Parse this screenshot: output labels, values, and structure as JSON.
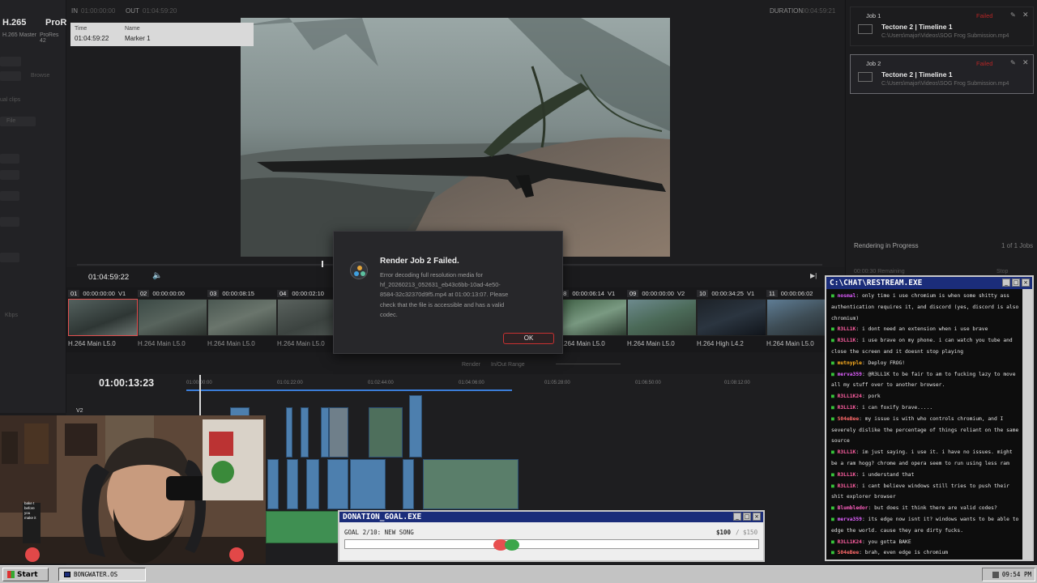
{
  "left_panel": {
    "format_title": "H.265",
    "format_sub": "H.265 Master",
    "format_title2": "ProRe",
    "format_sub2": "ProRes 42",
    "ghost_labels": [
      "Browse",
      "ual clips",
      "File",
      "Kbps"
    ]
  },
  "viewer": {
    "in_label": "IN",
    "in_tc": "01:00:00:00",
    "out_label": "OUT",
    "out_tc": "01:04:59:20",
    "duration_label": "DURATION",
    "duration_tc": "00:04:59:21",
    "marker_time_label": "Time",
    "marker_time": "01:04:59:22",
    "marker_name_label": "Name",
    "marker_name": "Marker 1",
    "timecode": "01:04:59:22"
  },
  "clips": [
    {
      "idx": "01",
      "tc": "00:00:00:00",
      "track": "V1",
      "codec": "H.264 Main L5.0"
    },
    {
      "idx": "02",
      "tc": "00:00:00:00",
      "track": "",
      "codec": "H.264 Main L5.0"
    },
    {
      "idx": "03",
      "tc": "00:00:08:15",
      "track": "",
      "codec": "H.264 Main L5.0"
    },
    {
      "idx": "04",
      "tc": "00:00:02:10",
      "track": "",
      "codec": "H.264 Main L5.0"
    },
    {
      "idx": "08",
      "tc": "00:00:06:14",
      "track": "V1",
      "codec": "H.264 Main L5.0"
    },
    {
      "idx": "09",
      "tc": "00:00:00:00",
      "track": "V2",
      "codec": "H.264 Main L5.0"
    },
    {
      "idx": "10",
      "tc": "00:00:34:25",
      "track": "V1",
      "codec": "H.264 High L4.2"
    },
    {
      "idx": "11",
      "tc": "00:00:06:02",
      "track": "",
      "codec": "H.264 Main L5.0"
    }
  ],
  "render_strip": {
    "render_label": "Render",
    "render_value": "In/Out Range"
  },
  "timeline": {
    "timecode": "01:00:13:23",
    "track_label": "V2",
    "ruler": [
      "01:00:00:00",
      "01:01:22:00",
      "01:02:44:00",
      "01:04:06:00",
      "01:05:28:00",
      "01:06:50:00",
      "01:08:12:00"
    ]
  },
  "render_queue": {
    "jobs": [
      {
        "id": "Job 1",
        "status": "Failed",
        "name": "Tectone 2 | Timeline 1",
        "path": "C:\\Users\\major\\Videos\\SOG Frog Submission.mp4"
      },
      {
        "id": "Job 2",
        "status": "Failed",
        "name": "Tectone 2 | Timeline 1",
        "path": "C:\\Users\\major\\Videos\\SOG Frog Submission.mp4"
      }
    ],
    "progress_label": "Rendering in Progress",
    "progress_count": "1 of 1 Jobs",
    "remaining": "00:00:30 Remaining",
    "stop_label": "Stop"
  },
  "dialog": {
    "title": "Render Job 2 Failed.",
    "message": "Error decoding full resolution media for hf_20260213_052631_eb43c6bb-10ad-4e50-8584-32c32370d9f5.mp4 at 01:00:13:07. Please check that the file is accessible and has a valid codec.",
    "ok_label": "OK"
  },
  "webcam": {
    "sign_text": "bake t before you make it"
  },
  "chat": {
    "title": "C:\\CHAT\\RESTREAM.EXE",
    "messages": [
      {
        "user": "nosmal",
        "text": "only time i use chromium is when some shitty ass authentication requires it, and discord (yes, discord is also chromium)",
        "color": "#e05cff"
      },
      {
        "user": "R3LL1K",
        "text": "i dont need an extension when i use brave",
        "color": "#ff5fa2"
      },
      {
        "user": "R3LL1K",
        "text": "i use brave on my phone. i can watch you tube and close the screen and it doesnt stop playing",
        "color": "#ff5fa2"
      },
      {
        "user": "mutnyple",
        "text": "Deploy FROG!",
        "color": "#ffb020"
      },
      {
        "user": "merva359",
        "text": "@R3LL1K to be fair to am to fucking lazy to move all my stuff over to another browser.",
        "color": "#e060ff"
      },
      {
        "user": "R3LL1K24",
        "text": "pork",
        "color": "#ff5fa2"
      },
      {
        "user": "R3LL1K",
        "text": "i can foxify brave.....",
        "color": "#ff5fa2"
      },
      {
        "user": "S04eBee",
        "text": "my issue is with who controls chromium, and I severely dislike the percentage of things reliant on the same source",
        "color": "#ff6a6a"
      },
      {
        "user": "R3LL1K",
        "text": "im just saying. i use it. i have no issues. might be a ram hogg? chrome and opera seem to run using less ram",
        "color": "#ff5fa2"
      },
      {
        "user": "R3LL1K",
        "text": "i understand that",
        "color": "#ff5fa2"
      },
      {
        "user": "R3LL1K",
        "text": "i cant believe windows still tries to push their shit explorer browser",
        "color": "#ff5fa2"
      },
      {
        "user": "Blumbledor",
        "text": "but does it think there are valid codes?",
        "color": "#ff60c0"
      },
      {
        "user": "merva359",
        "text": "its edge now isnt it? windows wants to be able to edge the world. cause they are dirty fucks.",
        "color": "#e060ff"
      },
      {
        "user": "R3LL1K24",
        "text": "you gotta BAKE",
        "color": "#ff5fa2"
      },
      {
        "user": "S04eBee",
        "text": "brah, even edge is chromium",
        "color": "#ff6a6a"
      },
      {
        "user": "R3LL1K24",
        "text": "bake t before you make it",
        "color": "#ff5fa2"
      }
    ]
  },
  "donation": {
    "title": "DONATION_GOAL.EXE",
    "goal_text": "GOAL 2/10: NEW SONG",
    "current": "$100",
    "target": "/ $150",
    "progress": 0.6667
  },
  "taskbar": {
    "start_label": "Start",
    "task_label": "BONGWATER.OS",
    "clock": "09:54 PM"
  },
  "colors": {
    "error_red": "#c83232",
    "win_titlebar": "#1b2d7a",
    "clip_blue": "#4d7fae",
    "clip_green": "#3f8f52"
  }
}
